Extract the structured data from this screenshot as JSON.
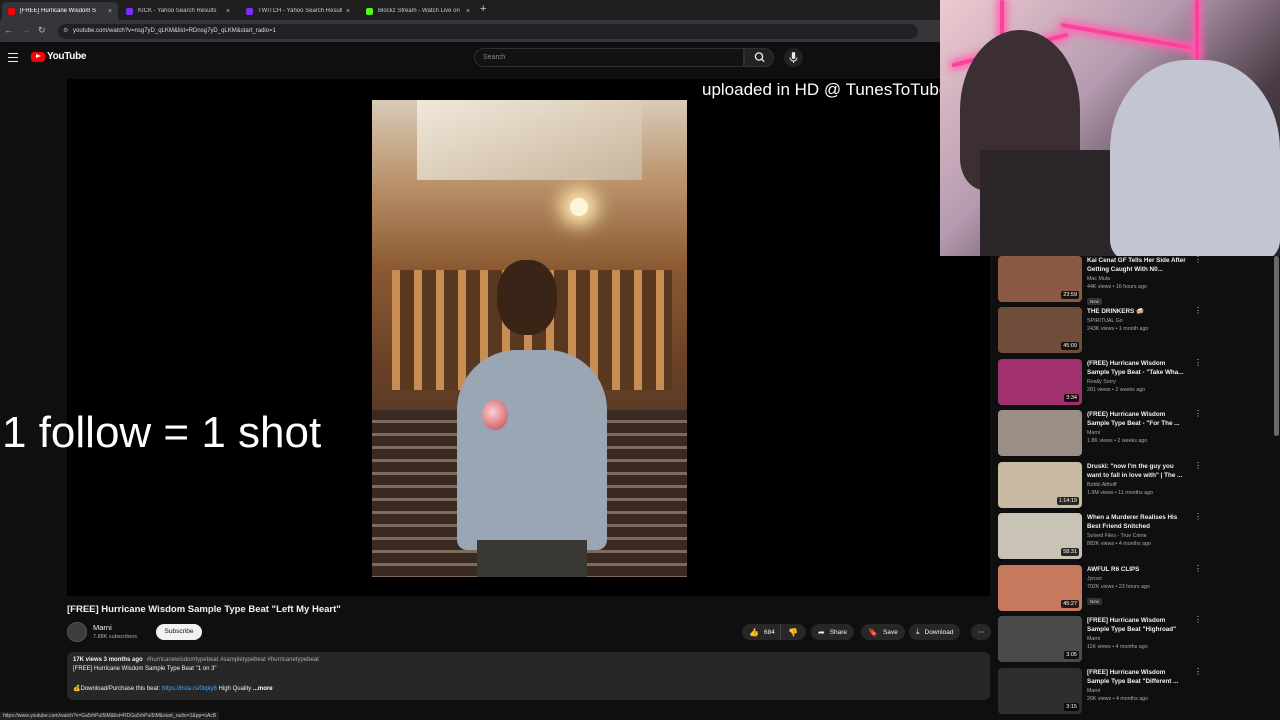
{
  "browser": {
    "tabs": [
      {
        "label": "[FREE] Hurricane Wisdom S",
        "favicon_color": "#ff0000",
        "active": true
      },
      {
        "label": "KICK - Yahoo Search Results",
        "favicon_color": "#7b2cff",
        "active": false
      },
      {
        "label": "TWITCH - Yahoo Search Results",
        "favicon_color": "#7b2cff",
        "active": false
      },
      {
        "label": "Blockz Stream - Watch Live on K",
        "favicon_color": "#53fc18",
        "active": false
      }
    ],
    "new_tab_label": "+",
    "url": "youtube.com/watch?v=nsg7yD_qLKM&list=RDnsg7yD_qLKM&start_radio=1",
    "status_url": "https://www.youtube.com/watch?v=Ga5rhPuI5iM&list=RDGa5rhPuI5iM&start_radio=1&pp=oAcB"
  },
  "header": {
    "logo_text": "YouTube",
    "search_placeholder": "Search"
  },
  "player": {
    "overlay_left": "1 follow = 1 shot",
    "overlay_top": "uploaded in HD @ TunesToTube"
  },
  "video": {
    "title": "[FREE] Hurricane Wisdom Sample Type Beat \"Left My Heart\"",
    "channel": "Marni",
    "subscribers": "7.88K subscribers",
    "subscribe_label": "Subscribe",
    "likes": "684",
    "share_label": "Share",
    "save_label": "Save",
    "download_label": "Download",
    "views_date": "17K views  3 months ago",
    "hashtags": "#hurricanewisdomtypebeat #sampletypebeat #hurricanetypebeat",
    "desc_line": "[FREE] Hurricane Wisdom Sample Type Beat \"1 on 3\"",
    "desc_download_prefix": "💰Download/Purchase this beat: ",
    "desc_link": "https://bsta.rs/0lqky6",
    "desc_suffix": " High Quality",
    "more_label": " ...more"
  },
  "sidebar": {
    "items": [
      {
        "title": "Kai Cenat GF Tells Her Side After Getting Caught With N0...",
        "channel": "Mac Mula",
        "meta": "44K views • 16 hours ago",
        "badge": "New",
        "duration": "23:59",
        "thumb_color": "#8a5a44"
      },
      {
        "title": "THE DRINKERS 🍻",
        "channel": "SPIRITUAL Go",
        "meta": "243K views • 1 month ago",
        "badge": "",
        "duration": "45:09",
        "thumb_color": "#6e4d3a"
      },
      {
        "title": "(FREE) Hurricane Wisdom Sample Type Beat - \"Take Wha...",
        "channel": "Really Sorry",
        "meta": "281 views • 2 weeks ago",
        "badge": "",
        "duration": "3:34",
        "thumb_color": "#a0306e"
      },
      {
        "title": "(FREE) Hurricane Wisdom Sample Type Beat - \"For The ...",
        "channel": "Marni",
        "meta": "1.8K views • 2 weeks ago",
        "badge": "",
        "duration": "",
        "thumb_color": "#9a8e86"
      },
      {
        "title": "Druski: \"now I'm the guy you want to fall in love with\" | The ...",
        "channel": "Bobbi Althoff",
        "meta": "1.9M views • 11 months ago",
        "badge": "",
        "duration": "1:14:19",
        "thumb_color": "#c8b9a2"
      },
      {
        "title": "When a Murderer Realises His Best Friend Snitched",
        "channel": "Solved Files - True Crime",
        "meta": "882K views • 4 months ago",
        "badge": "",
        "duration": "58:31",
        "thumb_color": "#c9c3b6"
      },
      {
        "title": "AWFUL R6 CLIPS",
        "channel": "Jynxzi",
        "meta": "702K views • 23 hours ago",
        "badge": "New",
        "duration": "45:27",
        "thumb_color": "#c57a5e"
      },
      {
        "title": "[FREE] Hurricane Wisdom Sample Type Beat \"Highroad\"",
        "channel": "Marni",
        "meta": "11K views • 4 months ago",
        "badge": "",
        "duration": "3:05",
        "thumb_color": "#4a4a4a"
      },
      {
        "title": "[FREE] Hurricane Wisdom Sample Type Beat \"Different ...",
        "channel": "Marni",
        "meta": "26K views • 4 months ago",
        "badge": "",
        "duration": "3:15",
        "thumb_color": "#2e2e2e"
      }
    ]
  }
}
